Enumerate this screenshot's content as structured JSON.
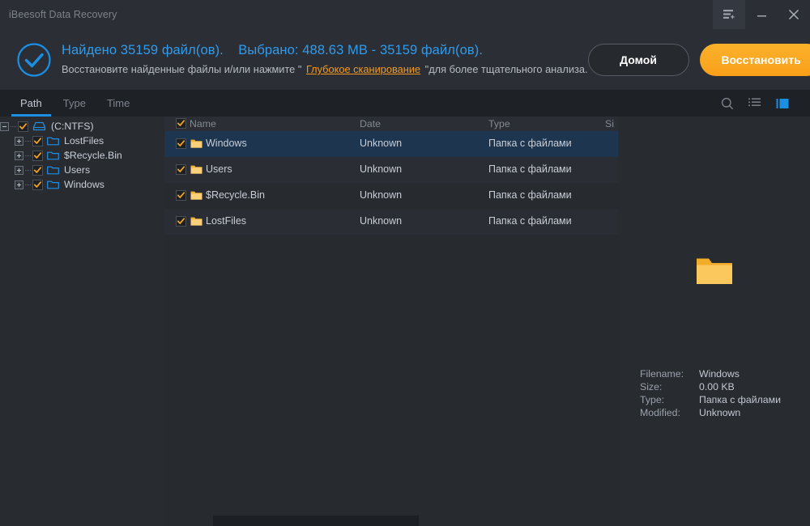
{
  "window": {
    "title": "iBeesoft Data Recovery",
    "controls": [
      {
        "name": "feedback-log-icon",
        "label": "Feedback"
      },
      {
        "name": "minimize-icon",
        "label": "Minimize"
      },
      {
        "name": "close-icon",
        "label": "Close"
      }
    ]
  },
  "banner": {
    "status_icon": "check-circle-icon",
    "found_text": "Найдено 35159 файл(ов).",
    "selected_text": "Выбрано: 488.63 MB - 35159 файл(ов).",
    "hint_prefix": "Восстановите найденные файлы и/или нажмите \"",
    "hint_link": "Глубокое сканирование",
    "hint_suffix": "\"для более тщательного анализа.",
    "home_button": "Домой",
    "recover_button": "Восстановить",
    "accent_blue": "#2f9bec",
    "accent_orange": "#f9a01a"
  },
  "tabs": {
    "items": [
      {
        "label": "Path",
        "active": true
      },
      {
        "label": "Type",
        "active": false
      },
      {
        "label": "Time",
        "active": false
      }
    ],
    "toolbar": [
      {
        "name": "search-icon",
        "label": "Search"
      },
      {
        "name": "list-view-icon",
        "label": "List view"
      },
      {
        "name": "preview-pane-icon",
        "label": "Preview pane",
        "active": true,
        "color": "#1a8fe3"
      }
    ]
  },
  "tree": {
    "root": {
      "label": "(C:NTFS)",
      "expanded": true,
      "checked": true,
      "icon": "drive-icon"
    },
    "children": [
      {
        "label": "LostFiles",
        "expanded": false,
        "checked": true,
        "icon": "folder-outline-icon"
      },
      {
        "label": "$Recycle.Bin",
        "expanded": false,
        "checked": true,
        "icon": "folder-outline-icon"
      },
      {
        "label": "Users",
        "expanded": false,
        "checked": true,
        "icon": "folder-outline-icon"
      },
      {
        "label": "Windows",
        "expanded": false,
        "checked": true,
        "icon": "folder-outline-icon"
      }
    ]
  },
  "filelist": {
    "columns": [
      "Name",
      "Date",
      "Type",
      "Si"
    ],
    "header_checked": true,
    "rows": [
      {
        "name": "Windows",
        "date": "Unknown",
        "type": "Папка с файлами",
        "size": "",
        "checked": true,
        "selected": true
      },
      {
        "name": "Users",
        "date": "Unknown",
        "type": "Папка с файлами",
        "size": "",
        "checked": true,
        "selected": false
      },
      {
        "name": "$Recycle.Bin",
        "date": "Unknown",
        "type": "Папка с файлами",
        "size": "",
        "checked": true,
        "selected": false
      },
      {
        "name": "LostFiles",
        "date": "Unknown",
        "type": "Папка с файлами",
        "size": "",
        "checked": true,
        "selected": false
      }
    ]
  },
  "preview": {
    "icon": "folder-icon",
    "fields": [
      {
        "key": "Filename:",
        "value": "Windows"
      },
      {
        "key": "Size:",
        "value": "0.00 KB"
      },
      {
        "key": "Type:",
        "value": "Папка с файлами"
      },
      {
        "key": "Modified:",
        "value": "Unknown"
      }
    ]
  }
}
